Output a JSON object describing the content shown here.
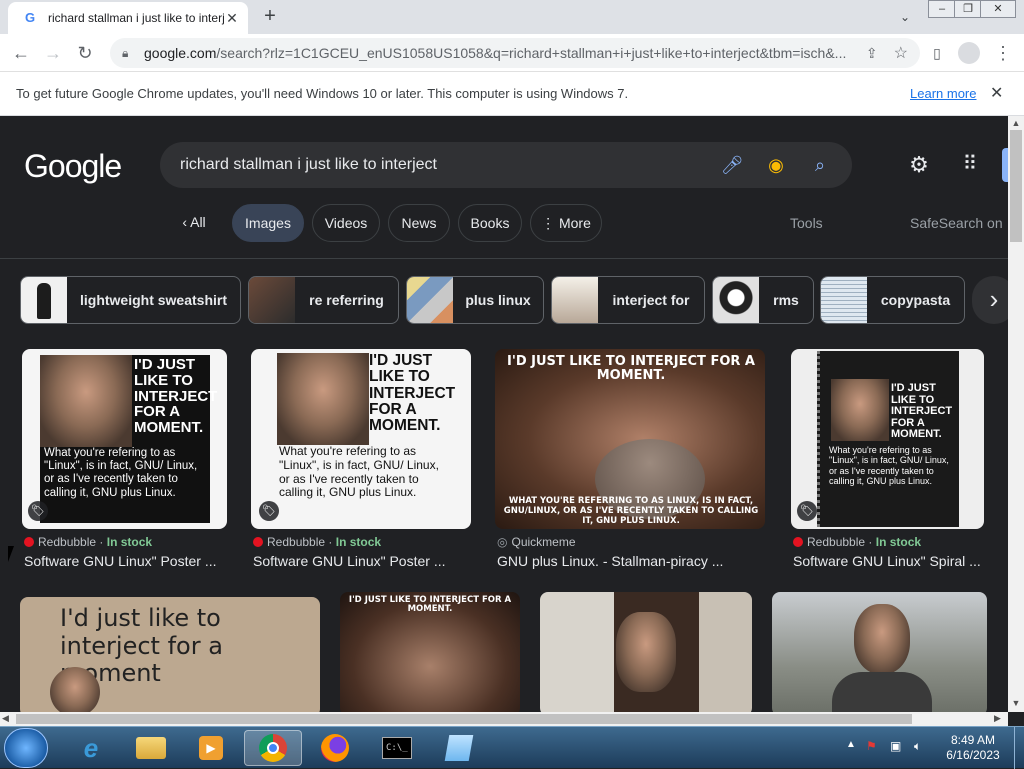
{
  "browser": {
    "tab_title": "richard stallman i just like to interje",
    "tab_favicon": "G",
    "url_host": "google.com",
    "url_rest": "/search?rlz=1C1GCEU_enUS1058US1058&q=richard+stallman+i+just+like+to+interject&tbm=isch&..."
  },
  "infobar": {
    "message": "To get future Google Chrome updates, you'll need Windows 10 or later. This computer is using Windows 7.",
    "learn_more": "Learn more"
  },
  "google": {
    "logo": "Google",
    "query": "richard stallman i just like to interject",
    "tabs": [
      {
        "label": "All",
        "prefix": "‹"
      },
      {
        "label": "Images"
      },
      {
        "label": "Videos"
      },
      {
        "label": "News"
      },
      {
        "label": "Books"
      },
      {
        "label": "More",
        "prefix": "⋮"
      }
    ],
    "tools": "Tools",
    "safesearch": "SafeSearch on",
    "chips": [
      {
        "label": "lightweight sweatshirt"
      },
      {
        "label": "re referring"
      },
      {
        "label": "plus linux"
      },
      {
        "label": "interject for"
      },
      {
        "label": "rms"
      },
      {
        "label": "copypasta"
      }
    ],
    "results": [
      {
        "source": "Redbubble",
        "stock": "In stock",
        "title": "Software GNU Linux\" Poster ...",
        "headline": "I'D JUST LIKE TO INTERJECT FOR A MOMENT.",
        "body": "What you're refering to as \"Linux\", is in fact, GNU/ Linux, or as I've recently taken to calling it, GNU plus Linux."
      },
      {
        "source": "Redbubble",
        "stock": "In stock",
        "title": "Software GNU Linux\" Poster ...",
        "headline": "I'D JUST LIKE TO INTERJECT FOR A MOMENT.",
        "body": "What you're refering to as \"Linux\", is in fact, GNU/ Linux, or as I've recently taken to calling it, GNU plus Linux."
      },
      {
        "source": "Quickmeme",
        "stock": "",
        "title": "GNU plus Linux. - Stallman-piracy ...",
        "headline": "I'D JUST LIKE TO INTERJECT FOR A MOMENT.",
        "body": "WHAT YOU'RE REFERRING TO AS LINUX, IS IN FACT, GNU/LINUX, OR AS I'VE RECENTLY TAKEN TO CALLING IT, GNU PLUS LINUX."
      },
      {
        "source": "Redbubble",
        "stock": "In stock",
        "title": "Software GNU Linux\" Spiral ...",
        "headline": "I'D JUST LIKE TO INTERJECT FOR A MOMENT.",
        "body": "What you're refering to as \"Linux\", is in fact, GNU/ Linux, or as I've recently taken to calling it, GNU plus Linux."
      }
    ],
    "row2": [
      {
        "caption": "I'd just like to interject for a moment"
      },
      {
        "caption": "I'D JUST LIKE TO INTERJECT FOR A MOMENT."
      },
      {
        "caption": ""
      },
      {
        "caption": ""
      }
    ]
  },
  "taskbar": {
    "time": "8:49 AM",
    "date": "6/16/2023"
  },
  "colors": {
    "page_bg": "#202124",
    "accent": "#8ab4f8",
    "stock": "#81c995"
  }
}
